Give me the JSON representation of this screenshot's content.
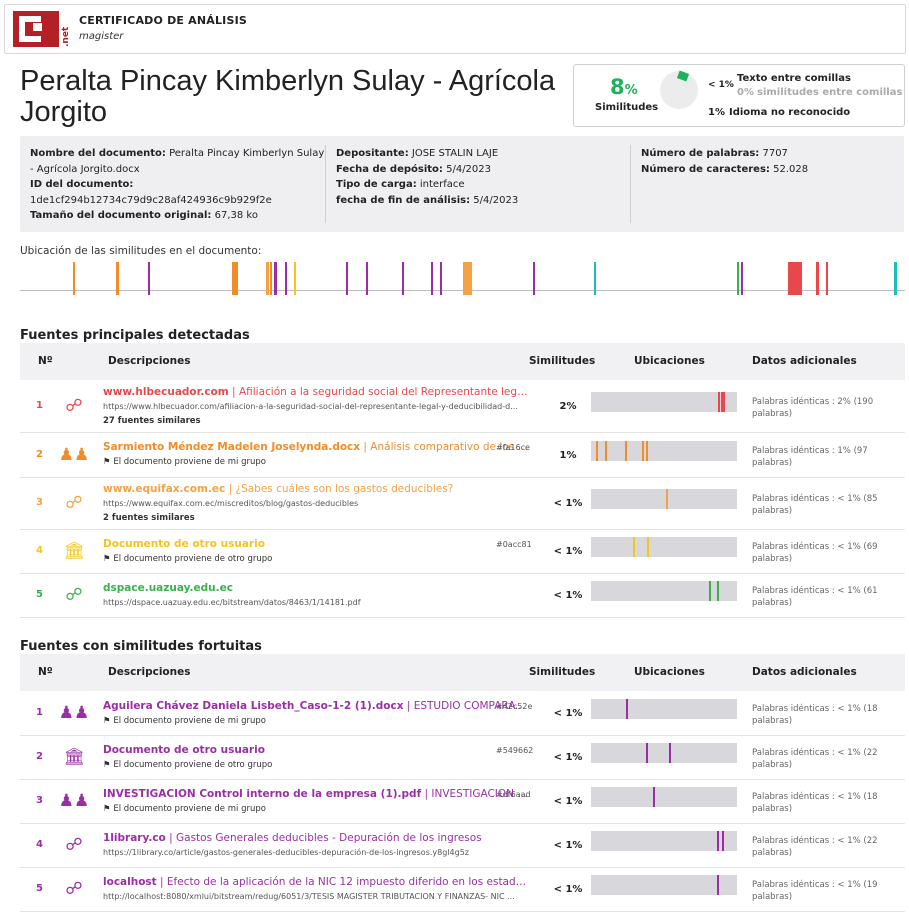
{
  "colors": {
    "brand": "#b32025",
    "green": "#1fb25a",
    "c1": "#e8474c",
    "c2": "#f28c28",
    "c3": "#f5a243",
    "c4": "#f5c518",
    "c5": "#36b34a",
    "purple": "#9a2fa5",
    "teal": "#1bbfbf"
  },
  "header": {
    "brand_suffix": ".net",
    "cert_title": "CERTIFICADO DE ANÁLISIS",
    "subtitle": "magister"
  },
  "doc_title": "Peralta Pincay Kimberlyn Sulay - Agrícola Jorgito",
  "similarity": {
    "percent": "8",
    "percent_sign": "%",
    "label": "Similitudes",
    "quoted_pct": "< 1%",
    "quoted_label": "Texto entre comillas",
    "quoted_sim_pct": "0%",
    "quoted_sim_label": "similitudes entre comillas",
    "unrecognized_pct": "1%",
    "unrecognized_label": "Idioma no reconocido"
  },
  "info": {
    "doc_name_label": "Nombre del documento:",
    "doc_name_value": "Peralta Pincay Kimberlyn Sulay - Agrícola Jorgito.docx",
    "id_label": "ID del documento:",
    "id_value": "1de1cf294b12734c79d9c28af424936c9b929f2e",
    "size_label": "Tamaño del documento original:",
    "size_value": "67,38 ko",
    "depositor_label": "Depositante:",
    "depositor_value": "JOSE STALIN LAJE",
    "deposit_date_label": "Fecha de depósito:",
    "deposit_date_value": "5/4/2023",
    "upload_type_label": "Tipo de carga:",
    "upload_type_value": "interface",
    "end_date_label": "fecha de fin de análisis:",
    "end_date_value": "5/4/2023",
    "words_label": "Número de palabras:",
    "words_value": "7707",
    "chars_label": "Número de caracteres:",
    "chars_value": "52.028"
  },
  "location_label": "Ubicación de las similitudes en el documento:",
  "table_headers": {
    "num": "Nº",
    "desc": "Descripciones",
    "sim": "Similitudes",
    "loc": "Ubicaciones",
    "extra": "Datos adicionales"
  },
  "main_sources_title": "Fuentes principales detectadas",
  "main_sources": [
    {
      "n": "1",
      "title": "www.hlbecuador.com",
      "desc": "Afiliación a la seguridad social del Representante legal y de...",
      "tag": "",
      "url": "https://www.hlbecuador.com/afiliacion-a-la-seguridad-social-del-representante-legal-y-deducibilidad-d...",
      "sub": "27 fuentes similares",
      "sim": "2%",
      "extra": "Palabras idénticas : 2% (190 palabras)",
      "icon": "web-icon"
    },
    {
      "n": "2",
      "title": "Sarmiento Méndez Madelen Joselynda.docx",
      "desc": "Análisis comparativo de los es...",
      "tag": "#fa16ce",
      "url": "",
      "sub": "El documento proviene de mi grupo",
      "sim": "1%",
      "extra": "Palabras idénticas : 1% (97 palabras)",
      "icon": "group-icon"
    },
    {
      "n": "3",
      "title": "www.equifax.com.ec",
      "desc": "¿Sabes cuáles son los gastos deducibles?",
      "tag": "",
      "url": "https://www.equifax.com.ec/miscreditos/blog/gastos-deducibles",
      "sub": "2 fuentes similares",
      "sim": "< 1%",
      "extra": "Palabras idénticas : < 1% (85 palabras)",
      "icon": "web-icon"
    },
    {
      "n": "4",
      "title": "Documento de otro usuario",
      "desc": "",
      "tag": "#0acc81",
      "url": "",
      "sub": "El documento proviene de otro grupo",
      "sim": "< 1%",
      "extra": "Palabras idénticas : < 1% (69 palabras)",
      "icon": "institution-icon"
    },
    {
      "n": "5",
      "title": "dspace.uazuay.edu.ec",
      "desc": "",
      "tag": "",
      "url": "https://dspace.uazuay.edu.ec/bitstream/datos/8463/1/14181.pdf",
      "sub": "",
      "sim": "< 1%",
      "extra": "Palabras idénticas : < 1% (61 palabras)",
      "icon": "web-icon"
    }
  ],
  "incidental_title": "Fuentes con similitudes fortuitas",
  "incidental_sources": [
    {
      "n": "1",
      "title": "Aguilera Chávez Daniela Lisbeth_Caso-1-2 (1).docx",
      "desc": "ESTUDIO COMPARATIV...",
      "tag": "#42c52e",
      "url": "",
      "sub": "El documento proviene de mi grupo",
      "sim": "< 1%",
      "extra": "Palabras idénticas : < 1% (18 palabras)",
      "icon": "group-icon"
    },
    {
      "n": "2",
      "title": "Documento de otro usuario",
      "desc": "",
      "tag": "#549662",
      "url": "",
      "sub": "El documento proviene de otro grupo",
      "sim": "< 1%",
      "extra": "Palabras idénticas : < 1% (22 palabras)",
      "icon": "institution-icon"
    },
    {
      "n": "3",
      "title": "INVESTIGACION Control interno de la empresa (1).pdf",
      "desc": "INVESTIGACION Co...",
      "tag": "#df6aad",
      "url": "",
      "sub": "El documento proviene de mi grupo",
      "sim": "< 1%",
      "extra": "Palabras idénticas : < 1% (18 palabras)",
      "icon": "group-icon"
    },
    {
      "n": "4",
      "title": "1library.co",
      "desc": "Gastos Generales deducibles - Depuración de los ingresos",
      "tag": "",
      "url": "https://1library.co/article/gastos-generales-deducibles-depuración-de-los-ingresos.y8gl4g5z",
      "sub": "",
      "sim": "< 1%",
      "extra": "Palabras idénticas : < 1% (22 palabras)",
      "icon": "web-icon"
    },
    {
      "n": "5",
      "title": "localhost",
      "desc": "Efecto de la aplicación de la NIC 12 impuesto diferido en los estados fina...",
      "tag": "",
      "url": "http://localhost:8080/xmlui/bitstream/redug/6051/3/TESIS MAGISTER TRIBUTACION Y FINANZAS- NIC ...",
      "sub": "",
      "sim": "< 1%",
      "extra": "Palabras idénticas : < 1% (19 palabras)",
      "icon": "web-icon"
    }
  ]
}
